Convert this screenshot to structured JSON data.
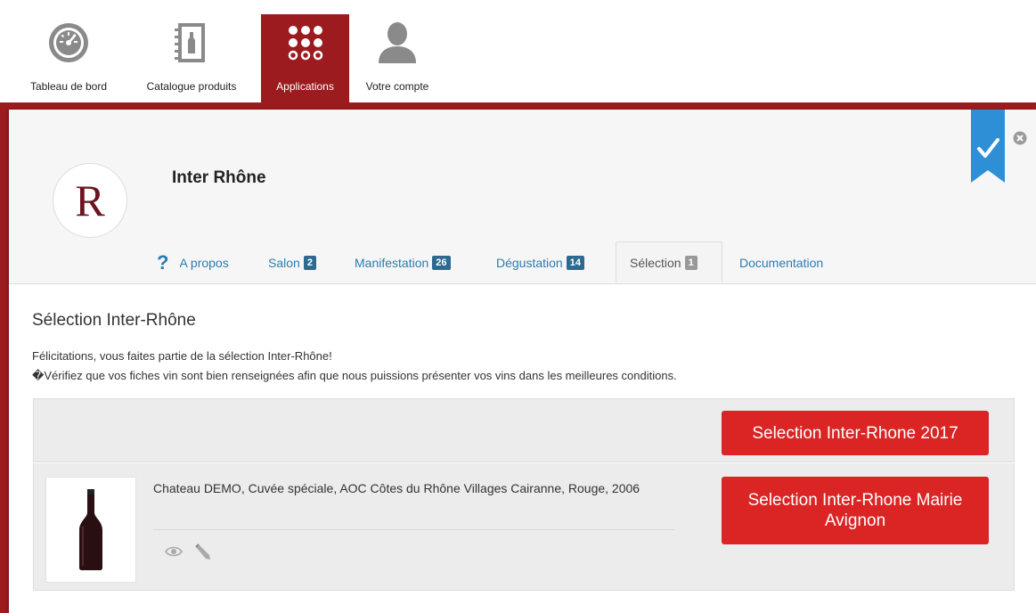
{
  "nav": {
    "items": [
      {
        "label": "Tableau de bord",
        "icon": "dashboard-gauge-icon"
      },
      {
        "label": "Catalogue produits",
        "icon": "catalog-book-icon"
      },
      {
        "label": "Applications",
        "icon": "apps-grid-icon",
        "active": true
      },
      {
        "label": "Votre compte",
        "icon": "user-account-icon"
      }
    ],
    "active_color": "#9b1b1f"
  },
  "org": {
    "logo_letter": "R",
    "name": "Inter Rhône"
  },
  "tabs": [
    {
      "label": "A propos",
      "icon": "help-question-icon"
    },
    {
      "label": "Salon",
      "badge": "2"
    },
    {
      "label": "Manifestation",
      "badge": "26"
    },
    {
      "label": "Dégustation",
      "badge": "14"
    },
    {
      "label": "Sélection",
      "badge": "1",
      "active": true
    },
    {
      "label": "Documentation"
    }
  ],
  "section": {
    "title": "Sélection Inter-Rhône",
    "congrats": "Félicitations, vous faites partie de la sélection Inter-Rhône!",
    "notice": "Vérifiez que vos fiches vin sont bien renseignées afin que nous puissions présenter vos vins dans les meilleures conditions.",
    "notice_prefix": "�"
  },
  "selections": {
    "button_2017": "Selection Inter-Rhone 2017",
    "button_avignon": "Selection Inter-Rhone Mairie Avignon"
  },
  "wine": {
    "description": "Chateau DEMO, Cuvée spéciale, AOC Côtes du Rhône Villages Cairanne, Rouge, 2006",
    "actions": [
      "view-eye-icon",
      "edit-pencil-icon"
    ]
  },
  "colors": {
    "brand": "#9b1b1f",
    "button": "#db2424",
    "link": "#2a7db2",
    "badge": "#2d6a8f",
    "bookmark": "#2f8fd6"
  }
}
